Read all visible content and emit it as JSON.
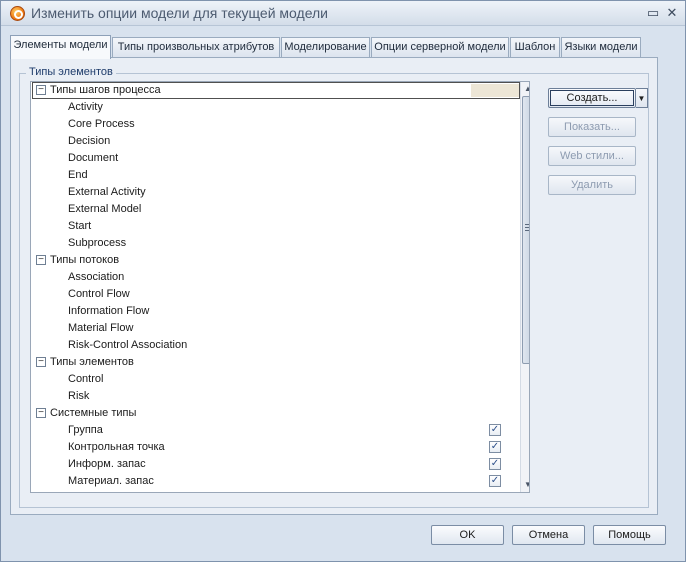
{
  "window": {
    "title": "Изменить опции модели для текущей модели",
    "minimize_glyph": "▭",
    "close_glyph": "✕"
  },
  "tabs": [
    {
      "label": "Элементы модели",
      "active": true
    },
    {
      "label": "Типы произвольных атрибутов",
      "active": false
    },
    {
      "label": "Моделирование",
      "active": false
    },
    {
      "label": "Опции серверной модели",
      "active": false
    },
    {
      "label": "Шаблон",
      "active": false
    },
    {
      "label": "Языки модели",
      "active": false
    }
  ],
  "group": {
    "title": "Типы элементов"
  },
  "tree": [
    {
      "type": "group",
      "label": "Типы шагов процесса",
      "expander": "−",
      "selected": true
    },
    {
      "type": "item",
      "label": "Activity"
    },
    {
      "type": "item",
      "label": "Core Process"
    },
    {
      "type": "item",
      "label": "Decision"
    },
    {
      "type": "item",
      "label": "Document"
    },
    {
      "type": "item",
      "label": "End"
    },
    {
      "type": "item",
      "label": "External Activity"
    },
    {
      "type": "item",
      "label": "External Model"
    },
    {
      "type": "item",
      "label": "Start"
    },
    {
      "type": "item",
      "label": "Subprocess"
    },
    {
      "type": "group",
      "label": "Типы потоков",
      "expander": "−"
    },
    {
      "type": "item",
      "label": "Association"
    },
    {
      "type": "item",
      "label": "Control Flow"
    },
    {
      "type": "item",
      "label": "Information Flow"
    },
    {
      "type": "item",
      "label": "Material Flow"
    },
    {
      "type": "item",
      "label": "Risk-Control Association"
    },
    {
      "type": "group",
      "label": "Типы элементов",
      "expander": "−"
    },
    {
      "type": "item",
      "label": "Control"
    },
    {
      "type": "item",
      "label": "Risk"
    },
    {
      "type": "group",
      "label": "Системные типы",
      "expander": "−"
    },
    {
      "type": "item",
      "label": "Группа",
      "checked": true
    },
    {
      "type": "item",
      "label": "Контрольная точка",
      "checked": true
    },
    {
      "type": "item",
      "label": "Информ. запас",
      "checked": true
    },
    {
      "type": "item",
      "label": "Материал. запас",
      "checked": true
    }
  ],
  "scrollbar": {
    "up": "▲",
    "down": "▼"
  },
  "side_buttons": {
    "create": "Создать...",
    "show": "Показать...",
    "web_styles": "Web стили...",
    "delete": "Удалить",
    "create_menu_arrow": "▼"
  },
  "footer": {
    "ok": "OK",
    "cancel": "Отмена",
    "help": "Помощь"
  },
  "check_glyph": "✓"
}
